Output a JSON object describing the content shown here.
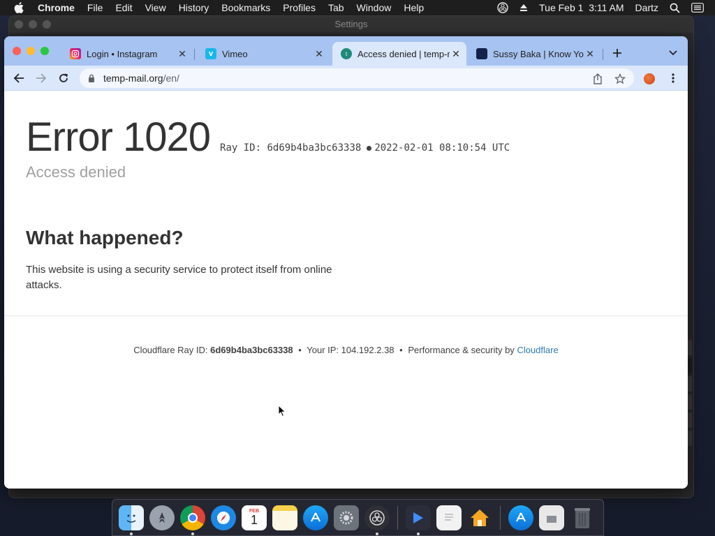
{
  "menubar": {
    "app_name": "Chrome",
    "menus": [
      "File",
      "Edit",
      "View",
      "History",
      "Bookmarks",
      "Profiles",
      "Tab",
      "Window",
      "Help"
    ],
    "datetime": "Tue Feb 1  3:11 AM",
    "user": "Dartz"
  },
  "settings_window": {
    "title": "Settings"
  },
  "browser": {
    "tabs": [
      {
        "title": "Login • Instagram",
        "icon": "instagram-icon"
      },
      {
        "title": "Vimeo",
        "icon": "vimeo-icon"
      },
      {
        "title": "Access denied | temp-mail.org",
        "icon": "temp-mail-icon"
      },
      {
        "title": "Sussy Baka | Know Your Meme",
        "icon": "know-your-meme-icon"
      }
    ],
    "active_tab_index": 2,
    "address": {
      "host": "temp-mail.org",
      "path": "/en/"
    }
  },
  "page": {
    "error_title": "Error 1020",
    "ray_label": "Ray ID: 6d69b4ba3bc63338",
    "timestamp": "2022-02-01 08:10:54 UTC",
    "subtitle": "Access denied",
    "what_heading": "What happened?",
    "what_body": "This website is using a security service to protect itself from online attacks.",
    "footer": {
      "ray_prefix": "Cloudflare Ray ID:",
      "ray_value": "6d69b4ba3bc63338",
      "ip_text": "Your IP: 104.192.2.38",
      "perf_text": "Performance & security by",
      "cf_link": "Cloudflare"
    }
  },
  "dock": {
    "apps": [
      "finder",
      "launchpad",
      "chrome",
      "safari",
      "calendar",
      "notes",
      "app-store",
      "system-preferences",
      "obs",
      "screen-recorder",
      "textedit",
      "home"
    ],
    "calendar": {
      "month": "FEB",
      "day": "1"
    },
    "right_items": [
      "app-store-folder",
      "documents-folder",
      "trash"
    ]
  },
  "colors": {
    "tabstrip": "#a7c3f1",
    "toolbar": "#dbe7fb",
    "link": "#2c7cb0"
  }
}
